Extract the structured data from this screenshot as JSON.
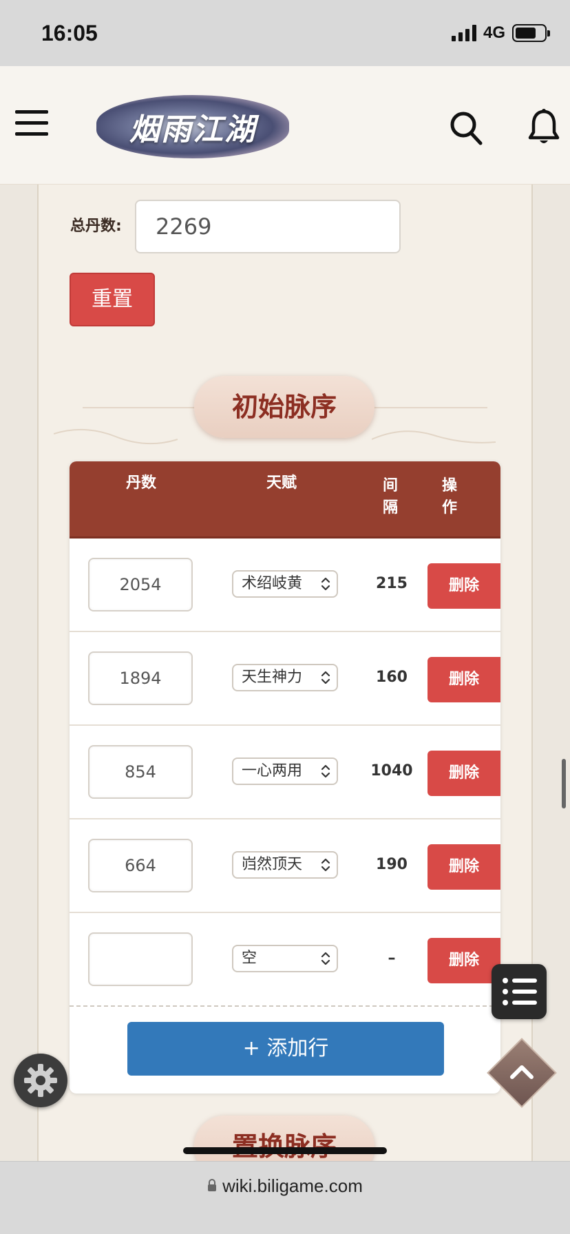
{
  "status_bar": {
    "time": "16:05",
    "network": "4G",
    "battery_level": 0.72
  },
  "header": {
    "logo_text": "烟雨江湖"
  },
  "total": {
    "label": "总丹数:",
    "value": "2269"
  },
  "reset_label": "重置",
  "section1_title": "初始脉序",
  "section2_title": "置换脉序",
  "table": {
    "headers": [
      "丹数",
      "天赋",
      "间隔",
      "操作"
    ],
    "rows": [
      {
        "dan": "2054",
        "talent": "术绍岐黄",
        "interval": "215",
        "action": "删除"
      },
      {
        "dan": "1894",
        "talent": "天生神力",
        "interval": "160",
        "action": "删除"
      },
      {
        "dan": "854",
        "talent": "一心两用",
        "interval": "1040",
        "action": "删除"
      },
      {
        "dan": "664",
        "talent": "岿然顶天",
        "interval": "190",
        "action": "删除"
      },
      {
        "dan": "",
        "talent": "空",
        "interval": "–",
        "action": "删除"
      }
    ],
    "add_row_label": "+ 添加行"
  },
  "browser": {
    "url": "wiki.biligame.com"
  },
  "icons": {
    "menu": "menu-icon",
    "search": "search-icon",
    "bell": "bell-icon",
    "toc": "list-icon",
    "settings": "gear-icon",
    "scroll_top": "chevron-up-icon",
    "lock": "lock-icon"
  },
  "colors": {
    "accent_red": "#d84a47",
    "table_head": "#953f2f",
    "add_blue": "#3379ba",
    "title_text": "#8c2e22"
  }
}
